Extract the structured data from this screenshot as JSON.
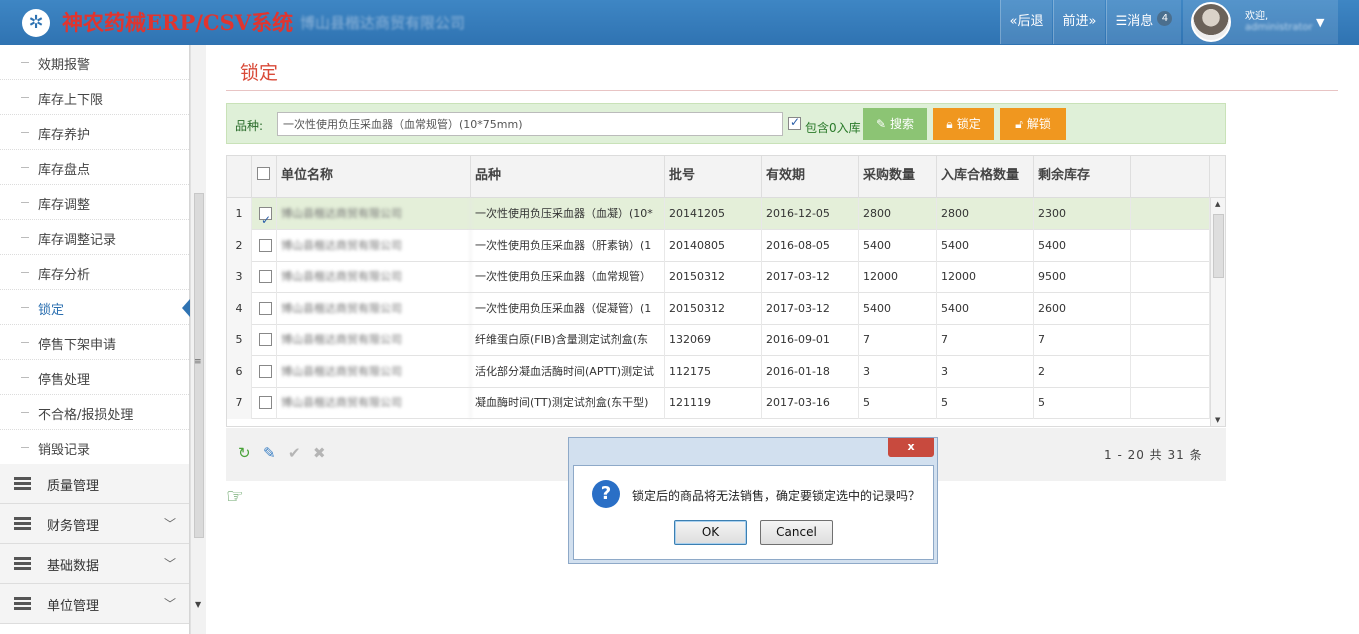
{
  "header": {
    "logo_glyph": "✲",
    "app_title": "神农药械ERP/CSV系统",
    "company": "博山县楷达商贸有限公司",
    "back_label": "«后退",
    "forward_label": "前进»",
    "messages_label": "消息",
    "messages_count": "4",
    "welcome": "欢迎,",
    "username": "administrator"
  },
  "sidebar": {
    "sub_items": [
      {
        "label": "效期报警"
      },
      {
        "label": "库存上下限"
      },
      {
        "label": "库存养护"
      },
      {
        "label": "库存盘点"
      },
      {
        "label": "库存调整"
      },
      {
        "label": "库存调整记录"
      },
      {
        "label": "库存分析"
      },
      {
        "label": "锁定",
        "active": true
      },
      {
        "label": "停售下架申请"
      },
      {
        "label": "停售处理"
      },
      {
        "label": "不合格/报损处理"
      },
      {
        "label": "销毁记录"
      }
    ],
    "main_items": [
      {
        "label": "质量管理",
        "icon": "list-icon"
      },
      {
        "label": "财务管理",
        "icon": "list-icon"
      },
      {
        "label": "基础数据",
        "icon": "list-icon"
      },
      {
        "label": "单位管理",
        "icon": "list-icon"
      }
    ]
  },
  "page": {
    "title": "锁定"
  },
  "search": {
    "label": "品种:",
    "value": "一次性使用负压采血器（血常规管）(10*75mm)",
    "include_zero_label": "包含0入库",
    "include_zero_checked": true,
    "search_label": "搜索",
    "lock_label": "锁定",
    "unlock_label": "解锁"
  },
  "grid": {
    "columns": [
      "",
      "单位名称",
      "品种",
      "批号",
      "有效期",
      "采购数量",
      "入库合格数量",
      "剩余库存",
      ""
    ],
    "rows": [
      {
        "num": "1",
        "checked": true,
        "unit": "博山县楷达商贸有限公司",
        "variety": "一次性使用负压采血器（血凝）(10*",
        "batch": "20141205",
        "expiry": "2016-12-05",
        "purchase": "2800",
        "qualified": "2800",
        "remaining": "2300"
      },
      {
        "num": "2",
        "checked": false,
        "unit": "博山县楷达商贸有限公司",
        "variety": "一次性使用负压采血器（肝素钠）(1",
        "batch": "20140805",
        "expiry": "2016-08-05",
        "purchase": "5400",
        "qualified": "5400",
        "remaining": "5400"
      },
      {
        "num": "3",
        "checked": false,
        "unit": "博山县楷达商贸有限公司",
        "variety": "一次性使用负压采血器（血常规管）",
        "batch": "20150312",
        "expiry": "2017-03-12",
        "purchase": "12000",
        "qualified": "12000",
        "remaining": "9500"
      },
      {
        "num": "4",
        "checked": false,
        "unit": "博山县楷达商贸有限公司",
        "variety": "一次性使用负压采血器（促凝管）(1",
        "batch": "20150312",
        "expiry": "2017-03-12",
        "purchase": "5400",
        "qualified": "5400",
        "remaining": "2600"
      },
      {
        "num": "5",
        "checked": false,
        "unit": "博山县楷达商贸有限公司",
        "variety": "纤维蛋白原(FIB)含量测定试剂盒(东",
        "batch": "132069",
        "expiry": "2016-09-01",
        "purchase": "7",
        "qualified": "7",
        "remaining": "7"
      },
      {
        "num": "6",
        "checked": false,
        "unit": "博山县楷达商贸有限公司",
        "variety": "活化部分凝血活酶时间(APTT)测定试",
        "batch": "112175",
        "expiry": "2016-01-18",
        "purchase": "3",
        "qualified": "3",
        "remaining": "2"
      },
      {
        "num": "7",
        "checked": false,
        "unit": "博山县楷达商贸有限公司",
        "variety": "凝血酶时间(TT)测定试剂盒(东干型)",
        "batch": "121119",
        "expiry": "2017-03-16",
        "purchase": "5",
        "qualified": "5",
        "remaining": "5"
      }
    ]
  },
  "footer": {
    "pager": "1 - 20  共 31 条",
    "refresh_icon": "↻",
    "edit_icon": "✎",
    "check_icon": "✔",
    "delete_icon": "✖",
    "hand_icon": "☞"
  },
  "dialog": {
    "close_glyph": "x",
    "message": "锁定后的商品将无法销售，确定要锁定选中的记录吗？",
    "ok_label": "OK",
    "cancel_label": "Cancel"
  },
  "colors": {
    "header_bg": "#2f73b2",
    "title_red": "#e0352f",
    "search_green": "#dff0d8",
    "search_btn": "#8cc474",
    "lock_btn": "#f0971f",
    "selected_row": "#e4efd9"
  }
}
